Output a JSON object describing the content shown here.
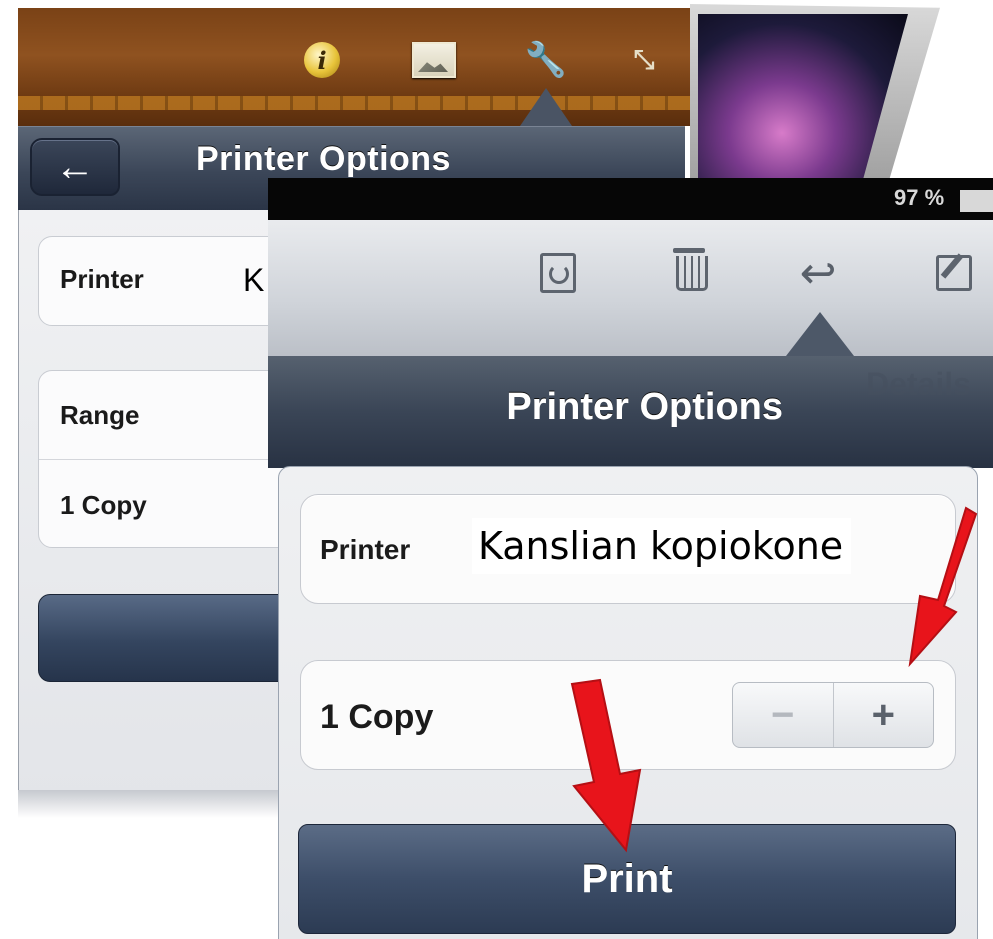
{
  "back_panel": {
    "toolbar_icons": [
      "info-icon",
      "image-icon",
      "wrench-icon",
      "expand-icon"
    ],
    "back_button_icon": "←",
    "title": "Printer Options",
    "printer_label": "Printer",
    "printer_value_partial": "K",
    "range_label": "Range",
    "copy_label": "1 Copy"
  },
  "front_panel": {
    "status": {
      "battery_percent": "97 %"
    },
    "toolbar_icons": [
      "folder-icon",
      "trash-icon",
      "reply-icon",
      "compose-icon"
    ],
    "reply_glyph": "↩",
    "details_ghost": "Details",
    "title": "Printer Options",
    "printer": {
      "label": "Printer",
      "value": "Kanslian kopiokone"
    },
    "copies": {
      "label": "1 Copy",
      "minus": "−",
      "plus": "+"
    },
    "print_button": "Print"
  },
  "colors": {
    "accent_red": "#e8141b",
    "toolbar_dark": "#2a3446"
  }
}
